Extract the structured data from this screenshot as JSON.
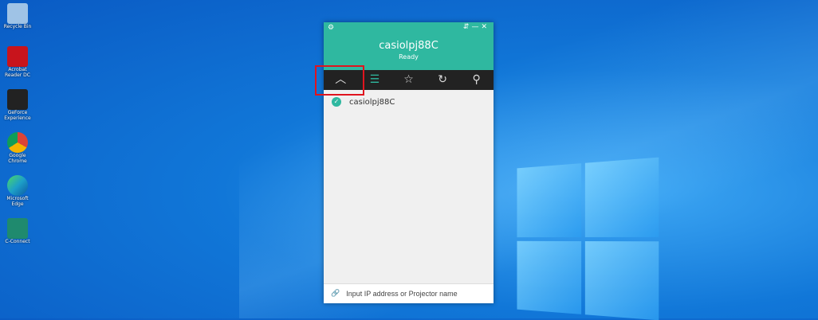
{
  "desktop": {
    "icons": [
      {
        "label": "Recycle Bin",
        "color": "#9fc3e6"
      },
      {
        "label": "Acrobat Reader DC",
        "color": "#c8141c"
      },
      {
        "label": "GeForce Experience",
        "color": "#222222"
      },
      {
        "label": "Google Chrome",
        "color": "#e0e0e0"
      },
      {
        "label": "Microsoft Edge",
        "color": "#1da0c8"
      },
      {
        "label": "C-Connect",
        "color": "#1f8a6e"
      }
    ]
  },
  "app": {
    "device_name": "casiolpj88C",
    "status": "Ready",
    "accent": "#2fb8a0",
    "toolbar": [
      "collapse-icon",
      "list-icon",
      "star-icon",
      "refresh-icon",
      "search-icon"
    ],
    "projectors": [
      {
        "name": "casiolpj88C",
        "connected": true
      }
    ],
    "input_placeholder": "Input IP address or Projector name"
  }
}
